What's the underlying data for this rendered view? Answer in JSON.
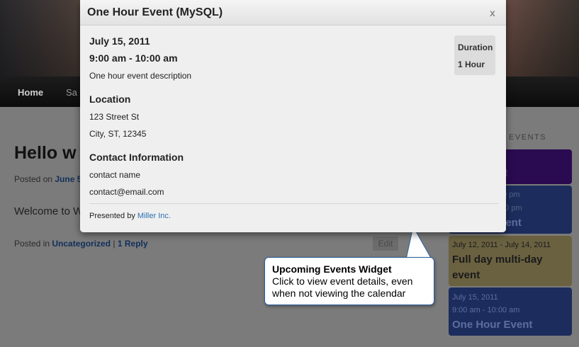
{
  "nav": {
    "items": [
      "Home",
      "Sa"
    ]
  },
  "post": {
    "title": "Hello w",
    "meta_prefix": "Posted on ",
    "meta_date": "June 5",
    "body": "Welcome to W",
    "footer_prefix": "Posted in ",
    "category": "Uncategorized",
    "separator": " | ",
    "reply": "1 Reply",
    "edit": "Edit"
  },
  "widget": {
    "title": "EVENTS",
    "events": [
      {
        "title": "nt",
        "color": "#2a0a50"
      },
      {
        "line1": "00 pm",
        "line2": ":30 pm",
        "title": "vent",
        "color": "#1c2c5c"
      },
      {
        "date": "July 12, 2011 - July 14, 2011",
        "title": "Full day multi-day event",
        "color": "#6a6141"
      },
      {
        "date": "July 15, 2011",
        "time": "9:00 am - 10:00 am",
        "title": "One Hour Event",
        "color": "#1c2c5c"
      }
    ]
  },
  "callout": {
    "title": "Upcoming Events Widget",
    "line1": "Click to view event details, even",
    "line2": "when not viewing the calendar"
  },
  "modal": {
    "title": "One Hour Event (MySQL)",
    "close": "x",
    "date": "July 15, 2011",
    "time": "9:00 am - 10:00 am",
    "description": "One hour event description",
    "location_heading": "Location",
    "address_line1": "123 Street St",
    "address_line2": "City, ST, 12345",
    "contact_heading": "Contact Information",
    "contact_name": "contact name",
    "contact_email": "contact@email.com",
    "presented_by": "Presented by ",
    "presenter": "Miller Inc.",
    "duration_label": "Duration",
    "duration_value": "1 Hour"
  },
  "colors": {
    "link": "#2a6fb5",
    "callout_border": "#2b5f9e",
    "overlay_bg": "#7b7b7b"
  }
}
